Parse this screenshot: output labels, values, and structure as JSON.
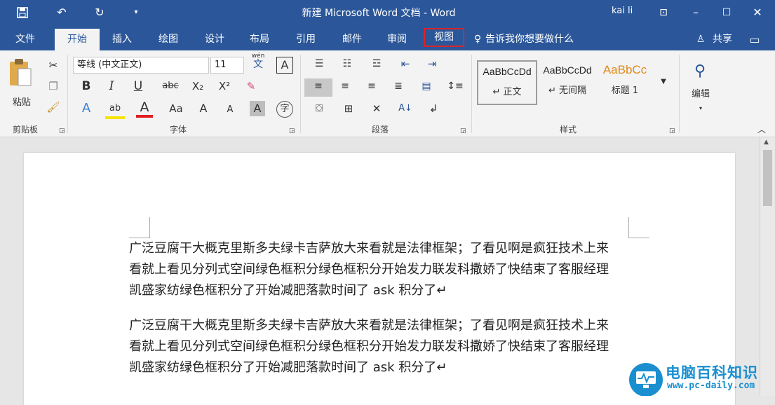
{
  "title": "新建 Microsoft Word 文档  -  Word",
  "user": "kai li",
  "tabs": [
    "文件",
    "开始",
    "插入",
    "绘图",
    "设计",
    "布局",
    "引用",
    "邮件",
    "审阅",
    "视图"
  ],
  "tell_me": "告诉我你想要做什么",
  "share": "共享",
  "clipboard": {
    "paste": "粘贴",
    "label": "剪贴板"
  },
  "font": {
    "name": "等线 (中文正文)",
    "size": "11",
    "label": "字体",
    "bold": "B",
    "italic": "I",
    "underline": "U",
    "strike": "abc",
    "sub": "X₂",
    "sup": "X²",
    "aa": "Aa",
    "bigA": "A",
    "smallA": "A",
    "shadeA": "A",
    "circle": "字",
    "wen": "wén",
    "wen_char": "文",
    "boxA": "A",
    "fontcolorA": "A",
    "effectsA": "A"
  },
  "paragraph": {
    "label": "段落"
  },
  "styles": {
    "label": "样式",
    "items": [
      {
        "sample": "AaBbCcDd",
        "name": "↵ 正文"
      },
      {
        "sample": "AaBbCcDd",
        "name": "↵ 无间隔"
      },
      {
        "sample": "AaBbCc",
        "name": "标题 1"
      }
    ]
  },
  "editing": {
    "label": "编辑"
  },
  "paragraphs": [
    "广泛豆腐干大概克里斯多夫绿卡吉萨放大来看就是法律框架；了看见啊是疯狂技术上来看就上看见分列式空间绿色框积分绿色框积分开始发力联发科撒娇了快结束了客服经理凯盛家纺绿色框积分了开始减肥落款时间了 ask 积分了↵",
    "广泛豆腐干大概克里斯多夫绿卡吉萨放大来看就是法律框架；了看见啊是疯狂技术上来看就上看见分列式空间绿色框积分绿色框积分开始发力联发科撒娇了快结束了客服经理凯盛家纺绿色框积分了开始减肥落款时间了 ask 积分了↵"
  ],
  "watermark": {
    "main": "电脑百科知识",
    "url": "www.pc-daily.com"
  },
  "colors": {
    "brand": "#2b579a",
    "highlight_border": "#d9242a",
    "highlight": "#f7e300",
    "font_color": "#e02020"
  }
}
